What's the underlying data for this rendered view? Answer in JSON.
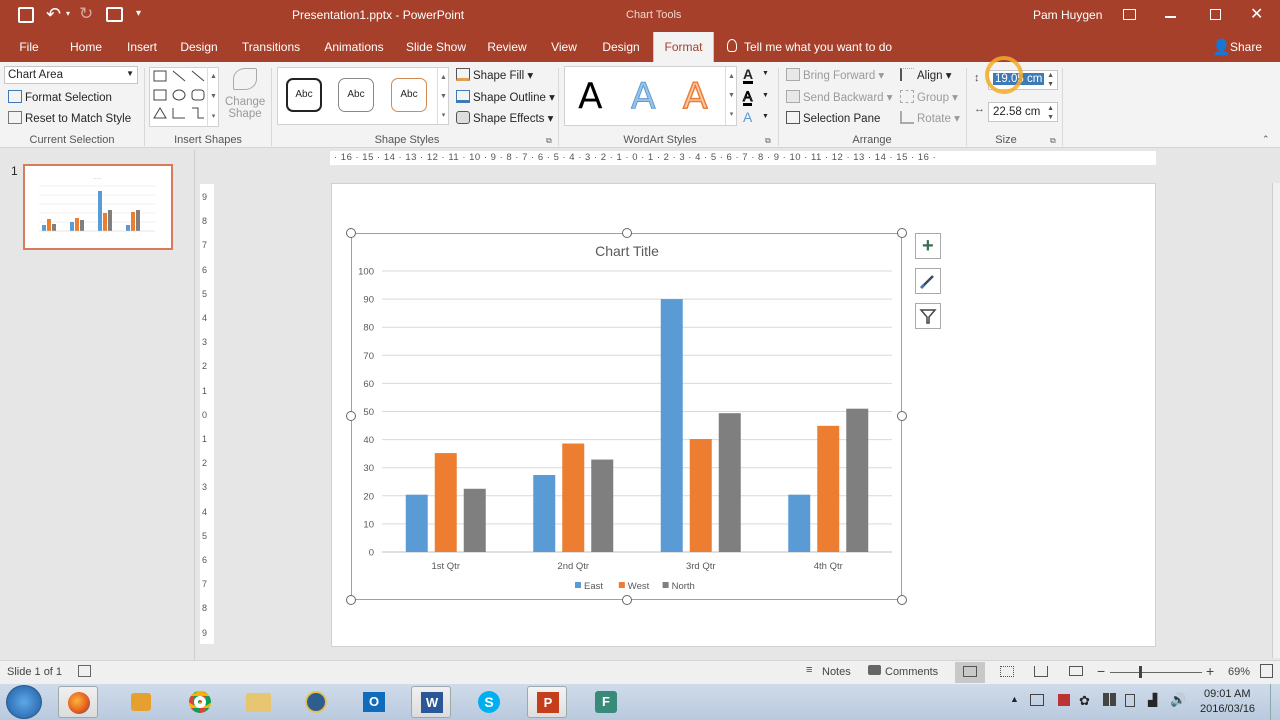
{
  "window": {
    "file_name": "Presentation1.pptx - PowerPoint",
    "context_tools": "Chart Tools",
    "user": "Pam Huygen"
  },
  "tabs": [
    "File",
    "Home",
    "Insert",
    "Design",
    "Transitions",
    "Animations",
    "Slide Show",
    "Review",
    "View",
    "Design",
    "Format"
  ],
  "tell_me": "Tell me what you want to do",
  "share": "Share",
  "ribbon": {
    "current_selection": {
      "dropdown_value": "Chart Area",
      "format_selection": "Format Selection",
      "reset_to_match": "Reset to Match Style",
      "label": "Current Selection"
    },
    "insert_shapes": {
      "change_shape": "Change",
      "change_shape2": "Shape",
      "label": "Insert Shapes"
    },
    "shape_styles": {
      "swatch_text": "Abc",
      "fill": "Shape Fill",
      "outline": "Shape Outline",
      "effects": "Shape Effects",
      "label": "Shape Styles"
    },
    "wordart": {
      "letter": "A",
      "label": "WordArt Styles"
    },
    "arrange": {
      "bring_forward": "Bring Forward",
      "send_backward": "Send Backward",
      "selection_pane": "Selection Pane",
      "align": "Align",
      "group": "Group",
      "rotate": "Rotate",
      "label": "Arrange"
    },
    "size": {
      "height": "19.05 cm",
      "width": "22.58 cm",
      "label": "Size"
    }
  },
  "ruler": {
    "h_ticks": "· 16 · 15 · 14 · 13 · 12 · 11 · 10 · 9 · 8 · 7 · 6 · 5 · 4 · 3 · 2 · 1 · 0 · 1 · 2 · 3 · 4 · 5 · 6 · 7 · 8 · 9 · 10 · 11 · 12 · 13 · 14 · 15 · 16 ·",
    "v_ticks": [
      "9",
      "8",
      "7",
      "6",
      "5",
      "4",
      "3",
      "2",
      "1",
      "0",
      "1",
      "2",
      "3",
      "4",
      "5",
      "6",
      "7",
      "8",
      "9"
    ]
  },
  "thumbnail": {
    "number": "1"
  },
  "chart_data": {
    "type": "bar",
    "title": "Chart Title",
    "categories": [
      "1st Qtr",
      "2nd Qtr",
      "3rd Qtr",
      "4th Qtr"
    ],
    "series": [
      {
        "name": "East",
        "values": [
          20.4,
          27.4,
          90,
          20.4
        ],
        "color": "#5b9bd5"
      },
      {
        "name": "West",
        "values": [
          35.2,
          38.6,
          40.2,
          44.9
        ],
        "color": "#ed7d31"
      },
      {
        "name": "North",
        "values": [
          22.5,
          32.9,
          49.4,
          51
        ],
        "color": "#7f7f7f"
      }
    ],
    "ylim": [
      0,
      100
    ],
    "yticks": [
      0,
      10,
      20,
      30,
      40,
      50,
      60,
      70,
      80,
      90,
      100
    ],
    "grid": true,
    "legend": "bottom"
  },
  "status": {
    "slide": "Slide 1 of 1",
    "notes": "Notes",
    "comments": "Comments",
    "zoom": "69%"
  },
  "clock": {
    "time": "09:01 AM",
    "date": "2016/03/16"
  },
  "colors": {
    "accent": "#a6402b"
  }
}
